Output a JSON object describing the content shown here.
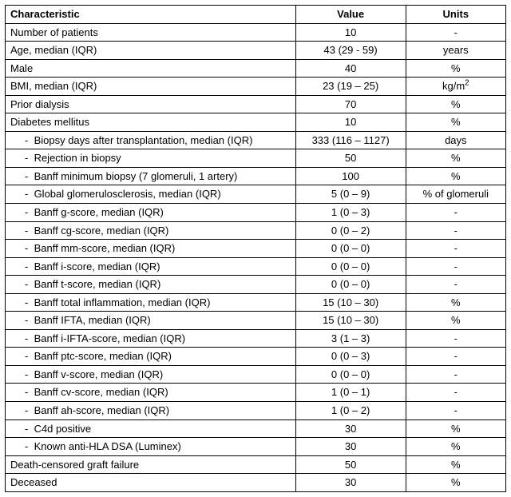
{
  "headers": {
    "c1": "Characteristic",
    "c2": "Value",
    "c3": "Units"
  },
  "rows": [
    {
      "indent": false,
      "c": "Number of patients",
      "v": "10",
      "u": "-"
    },
    {
      "indent": false,
      "c": "Age, median (IQR)",
      "v": "43 (29 - 59)",
      "u": "years"
    },
    {
      "indent": false,
      "c": "Male",
      "v": "40",
      "u": "%"
    },
    {
      "indent": false,
      "c": "BMI, median (IQR)",
      "v": "23 (19 – 25)",
      "u": "kg/m²"
    },
    {
      "indent": false,
      "c": "Prior dialysis",
      "v": "70",
      "u": "%"
    },
    {
      "indent": false,
      "c": "Diabetes mellitus",
      "v": "10",
      "u": "%"
    },
    {
      "indent": true,
      "c": "Biopsy days after transplantation, median (IQR)",
      "v": "333 (116 – 1127)",
      "u": "days"
    },
    {
      "indent": true,
      "c": "Rejection in biopsy",
      "v": "50",
      "u": "%"
    },
    {
      "indent": true,
      "c": "Banff minimum biopsy (7 glomeruli, 1 artery)",
      "v": "100",
      "u": "%"
    },
    {
      "indent": true,
      "c": "Global glomerulosclerosis, median (IQR)",
      "v": "5 (0 – 9)",
      "u": "% of glomeruli"
    },
    {
      "indent": true,
      "c": "Banff g-score, median (IQR)",
      "v": "1 (0 – 3)",
      "u": "-"
    },
    {
      "indent": true,
      "c": "Banff cg-score, median (IQR)",
      "v": "0 (0 – 2)",
      "u": "-"
    },
    {
      "indent": true,
      "c": "Banff mm-score, median (IQR)",
      "v": "0 (0 – 0)",
      "u": "-"
    },
    {
      "indent": true,
      "c": "Banff i-score, median (IQR)",
      "v": "0 (0 – 0)",
      "u": "-"
    },
    {
      "indent": true,
      "c": "Banff t-score, median (IQR)",
      "v": "0 (0 – 0)",
      "u": "-"
    },
    {
      "indent": true,
      "c": "Banff total inflammation, median (IQR)",
      "v": "15 (10 – 30)",
      "u": "%"
    },
    {
      "indent": true,
      "c": "Banff IFTA, median (IQR)",
      "v": "15 (10 – 30)",
      "u": "%"
    },
    {
      "indent": true,
      "c": "Banff i-IFTA-score, median (IQR)",
      "v": "3 (1 – 3)",
      "u": "-"
    },
    {
      "indent": true,
      "c": "Banff ptc-score, median (IQR)",
      "v": "0 (0 – 3)",
      "u": "-"
    },
    {
      "indent": true,
      "c": "Banff v-score, median (IQR)",
      "v": "0 (0 – 0)",
      "u": "-"
    },
    {
      "indent": true,
      "c": "Banff cv-score, median (IQR)",
      "v": "1 (0 – 1)",
      "u": "-"
    },
    {
      "indent": true,
      "c": "Banff ah-score, median (IQR)",
      "v": "1 (0 – 2)",
      "u": "-"
    },
    {
      "indent": true,
      "c": "C4d positive",
      "v": "30",
      "u": "%"
    },
    {
      "indent": true,
      "c": "Known anti-HLA DSA (Luminex)",
      "v": "30",
      "u": "%"
    },
    {
      "indent": false,
      "c": "Death-censored graft failure",
      "v": "50",
      "u": "%"
    },
    {
      "indent": false,
      "c": "Deceased",
      "v": "30",
      "u": "%"
    }
  ],
  "chart_data": {
    "type": "table",
    "title": "",
    "columns": [
      "Characteristic",
      "Value",
      "Units"
    ],
    "rows": [
      [
        "Number of patients",
        "10",
        "-"
      ],
      [
        "Age, median (IQR)",
        "43 (29 - 59)",
        "years"
      ],
      [
        "Male",
        "40",
        "%"
      ],
      [
        "BMI, median (IQR)",
        "23 (19 – 25)",
        "kg/m2"
      ],
      [
        "Prior dialysis",
        "70",
        "%"
      ],
      [
        "Diabetes mellitus",
        "10",
        "%"
      ],
      [
        "Biopsy days after transplantation, median (IQR)",
        "333 (116 – 1127)",
        "days"
      ],
      [
        "Rejection in biopsy",
        "50",
        "%"
      ],
      [
        "Banff minimum biopsy (7 glomeruli, 1 artery)",
        "100",
        "%"
      ],
      [
        "Global glomerulosclerosis, median (IQR)",
        "5 (0 – 9)",
        "% of glomeruli"
      ],
      [
        "Banff g-score, median (IQR)",
        "1 (0 – 3)",
        "-"
      ],
      [
        "Banff cg-score, median (IQR)",
        "0 (0 – 2)",
        "-"
      ],
      [
        "Banff mm-score, median (IQR)",
        "0 (0 – 0)",
        "-"
      ],
      [
        "Banff i-score, median (IQR)",
        "0 (0 – 0)",
        "-"
      ],
      [
        "Banff t-score, median (IQR)",
        "0 (0 – 0)",
        "-"
      ],
      [
        "Banff total inflammation, median (IQR)",
        "15 (10 – 30)",
        "%"
      ],
      [
        "Banff IFTA, median (IQR)",
        "15 (10 – 30)",
        "%"
      ],
      [
        "Banff i-IFTA-score, median (IQR)",
        "3 (1 – 3)",
        "-"
      ],
      [
        "Banff ptc-score, median (IQR)",
        "0 (0 – 3)",
        "-"
      ],
      [
        "Banff v-score, median (IQR)",
        "0 (0 – 0)",
        "-"
      ],
      [
        "Banff cv-score, median (IQR)",
        "1 (0 – 1)",
        "-"
      ],
      [
        "Banff ah-score, median (IQR)",
        "1 (0 – 2)",
        "-"
      ],
      [
        "C4d positive",
        "30",
        "%"
      ],
      [
        "Known anti-HLA DSA (Luminex)",
        "30",
        "%"
      ],
      [
        "Death-censored graft failure",
        "50",
        "%"
      ],
      [
        "Deceased",
        "30",
        "%"
      ]
    ]
  }
}
